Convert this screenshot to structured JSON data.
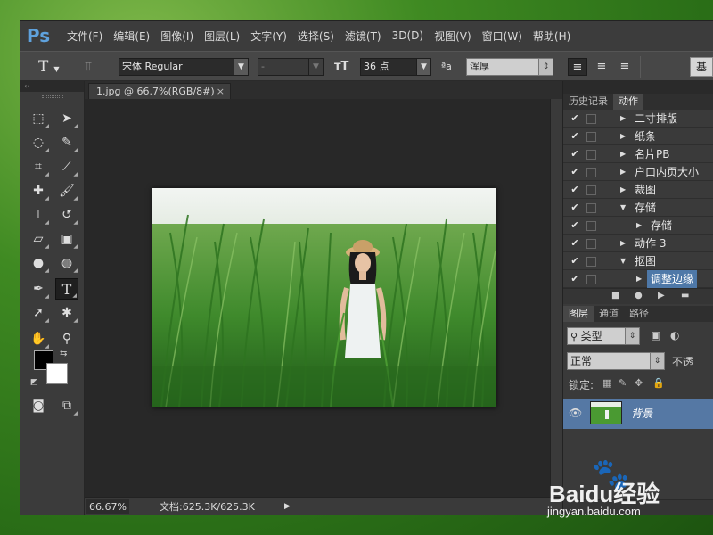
{
  "app": {
    "logo": "Ps",
    "menu": [
      "文件(F)",
      "编辑(E)",
      "图像(I)",
      "图层(L)",
      "文字(Y)",
      "选择(S)",
      "滤镜(T)",
      "3D(D)",
      "视图(V)",
      "窗口(W)",
      "帮助(H)"
    ]
  },
  "options": {
    "tool_icon": "T",
    "font_family": "宋体 Regular",
    "font_style": "-",
    "font_size": "36 点",
    "aa_label": "ªa",
    "antialias": "浑厚",
    "right_button": "基"
  },
  "toolbox": {
    "collapse": "‹‹"
  },
  "document": {
    "tab_title": "1.jpg @ 66.7%(RGB/8#)",
    "tab_close": "×",
    "zoom": "66.67%",
    "doc_info": "文档:625.3K/625.3K",
    "status_arrow": "▶"
  },
  "panels": {
    "top_tabs": [
      "历史记录",
      "动作"
    ],
    "actions": [
      {
        "label": "二寸排版",
        "indent": 1,
        "expanded": false,
        "selected": false
      },
      {
        "label": "纸条",
        "indent": 1,
        "expanded": false,
        "selected": false
      },
      {
        "label": "名片PB",
        "indent": 1,
        "expanded": false,
        "selected": false
      },
      {
        "label": "户口内页大小",
        "indent": 1,
        "expanded": false,
        "selected": false
      },
      {
        "label": "裁图",
        "indent": 1,
        "expanded": false,
        "selected": false
      },
      {
        "label": "存储",
        "indent": 1,
        "expanded": true,
        "selected": false
      },
      {
        "label": "存储",
        "indent": 2,
        "expanded": false,
        "selected": false
      },
      {
        "label": "动作 3",
        "indent": 1,
        "expanded": false,
        "selected": false
      },
      {
        "label": "抠图",
        "indent": 1,
        "expanded": true,
        "selected": false
      },
      {
        "label": "调整边缘",
        "indent": 2,
        "expanded": false,
        "selected": true
      }
    ],
    "layer_tabs": [
      "图层",
      "通道",
      "路径"
    ],
    "filter_kind": "类型",
    "blend_mode": "正常",
    "opacity_label": "不透",
    "lock_label": "锁定:",
    "layer_name": "背景"
  },
  "watermark": {
    "brand": "Baidu经验",
    "url": "jingyan.baidu.com"
  },
  "colors": {
    "accent": "#5fa2dd",
    "selection": "#5578a4",
    "desktop": "#3f8a22"
  }
}
